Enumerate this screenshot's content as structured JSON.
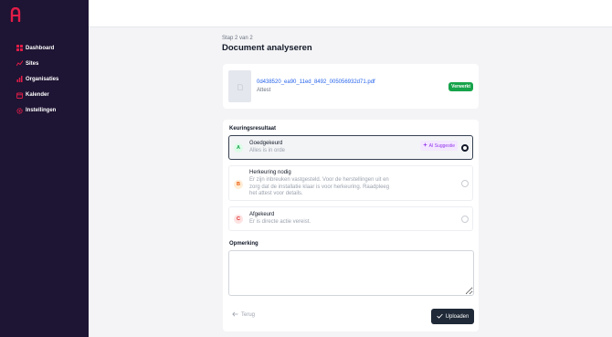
{
  "sidebar": {
    "items": [
      {
        "label": "Dashboard",
        "icon": "grid-icon"
      },
      {
        "label": "Sites",
        "icon": "chart-line-icon"
      },
      {
        "label": "Organisaties",
        "icon": "bar-chart-icon"
      },
      {
        "label": "Kalender",
        "icon": "calendar-icon"
      },
      {
        "label": "Instellingen",
        "icon": "gear-icon"
      }
    ]
  },
  "page": {
    "step": "Stap 2 van 2",
    "title": "Document analyseren"
  },
  "document": {
    "filename": "0d438520_ea90_11ed_8492_005056932d71.pdf",
    "type": "Attest",
    "status": "Verwerkt"
  },
  "result": {
    "label": "Keuringsresultaat",
    "options": [
      {
        "letter": "A",
        "title": "Goedgekeurd",
        "desc": "Alles is in orde",
        "tag": "AI Suggestie",
        "selected": true
      },
      {
        "letter": "B",
        "title": "Herkeuring nodig",
        "desc": "Er zijn inbreuken vastgesteld. Voor de herstellingen uit en zorg dat de installatie klaar is voor herkeuring. Raadpleeg het attest voor details.",
        "selected": false
      },
      {
        "letter": "C",
        "title": "Afgekeurd",
        "desc": "Er is directe actie vereist.",
        "selected": false
      }
    ]
  },
  "remark": {
    "label": "Opmerking",
    "value": ""
  },
  "actions": {
    "back": "Terug",
    "upload": "Uploaden"
  },
  "colors": {
    "sidebar_bg": "#1e1433",
    "accent_pink": "#e11d48",
    "badge_green": "#16a34a",
    "link_blue": "#2563eb",
    "ai_purple": "#9333ea",
    "button_dark": "#1f2937"
  }
}
